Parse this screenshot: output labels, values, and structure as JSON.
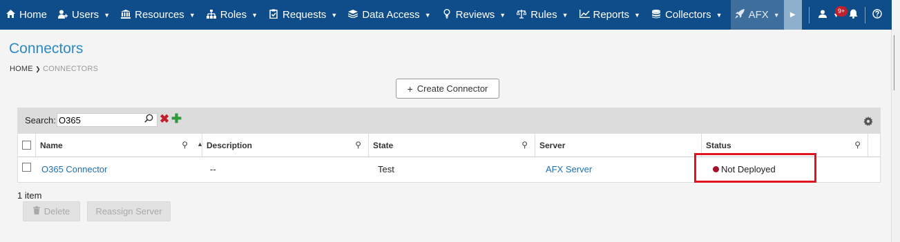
{
  "nav": {
    "items": [
      {
        "label": "Home",
        "icon": "home-icon",
        "caret": false
      },
      {
        "label": "Users",
        "icon": "users-icon",
        "caret": true
      },
      {
        "label": "Resources",
        "icon": "bank-icon",
        "caret": true
      },
      {
        "label": "Roles",
        "icon": "sitemap-icon",
        "caret": true
      },
      {
        "label": "Requests",
        "icon": "clipboard-check-icon",
        "caret": true
      },
      {
        "label": "Data Access",
        "icon": "layers-icon",
        "caret": true
      },
      {
        "label": "Reviews",
        "icon": "lightbulb-icon",
        "caret": true
      },
      {
        "label": "Rules",
        "icon": "scale-icon",
        "caret": true
      },
      {
        "label": "Reports",
        "icon": "chart-icon",
        "caret": true
      },
      {
        "label": "Collectors",
        "icon": "database-icon",
        "caret": true
      },
      {
        "label": "AFX",
        "icon": "rocket-icon",
        "caret": true
      }
    ],
    "notification_badge": "9+",
    "colors": {
      "navbar": "#0f4d8a",
      "active": "#3e6e9b"
    }
  },
  "page": {
    "title": "Connectors",
    "breadcrumb_home": "HOME",
    "breadcrumb_current": "CONNECTORS"
  },
  "create_button_label": "Create Connector",
  "grid": {
    "search_label": "Search:",
    "search_value": "O365",
    "columns": [
      "Name",
      "Description",
      "State",
      "Server",
      "Status"
    ],
    "rows": [
      {
        "name": "O365 Connector",
        "description": "--",
        "state": "Test",
        "server": "AFX Server",
        "status": "Not Deployed"
      }
    ],
    "item_count": "1 item"
  },
  "actions": {
    "delete_label": "Delete",
    "reassign_label": "Reassign Server"
  },
  "status_color": "#a6102a",
  "highlight_color": "#e0141e"
}
